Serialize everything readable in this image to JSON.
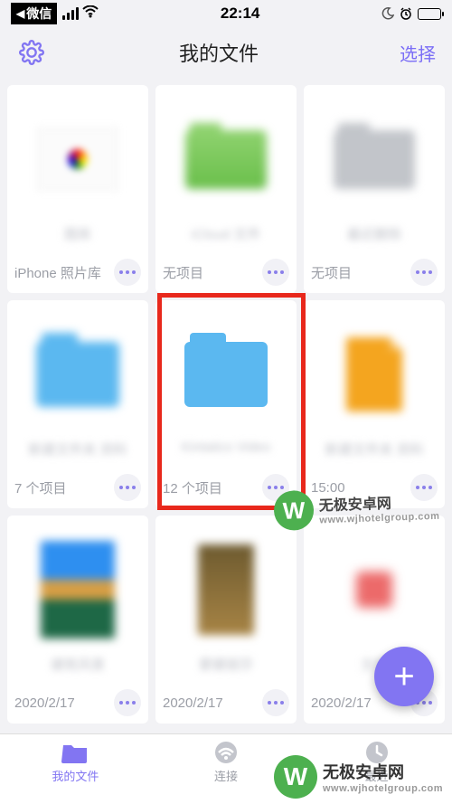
{
  "status": {
    "app_badge": "微信",
    "time": "22:14"
  },
  "nav": {
    "title": "我的文件",
    "select": "选择"
  },
  "tiles": [
    {
      "name": "图库",
      "sub": "iPhone 照片库",
      "thumb": "multi"
    },
    {
      "name": "iCloud 文件",
      "sub": "无项目",
      "thumb": "folder-green"
    },
    {
      "name": "最近删除",
      "sub": "无项目",
      "thumb": "folder-gray"
    },
    {
      "name": "新建文件夹 资料",
      "sub": "7 个项目",
      "thumb": "folder-blue-blur"
    },
    {
      "name": "Kintatics Video",
      "sub": "12 个项目",
      "thumb": "folder-blue"
    },
    {
      "name": "新建文件夹 资料",
      "sub": "15:00",
      "thumb": "file-orange"
    },
    {
      "name": "建筑风景",
      "sub": "2020/2/17",
      "thumb": "photo-1"
    },
    {
      "name": "蒙娜丽莎",
      "sub": "2020/2/17",
      "thumb": "photo-2"
    },
    {
      "name": "文件",
      "sub": "2020/2/17",
      "thumb": "file-red"
    }
  ],
  "bottom_nav": {
    "files": "我的文件",
    "connect": "连接",
    "recent": "最近"
  },
  "watermark": {
    "title": "无极安卓网",
    "url": "www.wjhotelgroup.com"
  }
}
